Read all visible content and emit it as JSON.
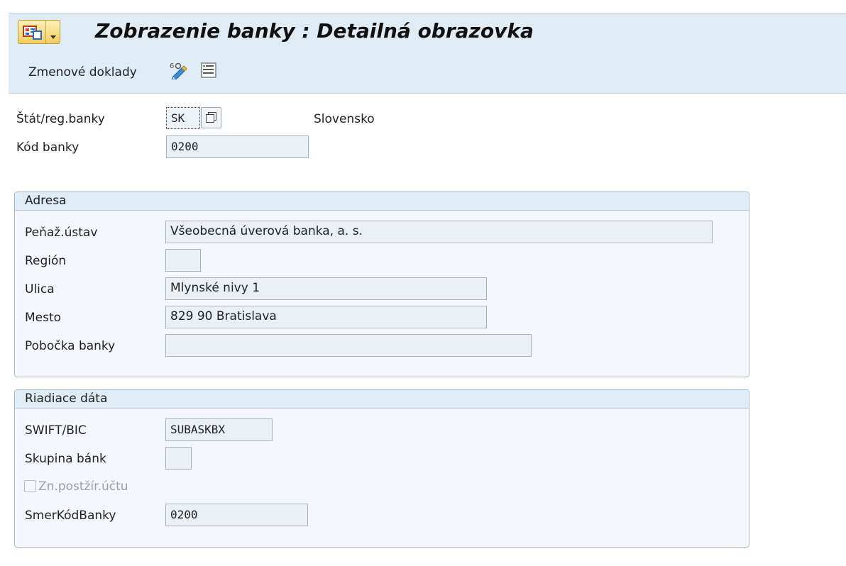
{
  "window": {
    "title": "Zobrazenie banky : Detailná obrazovka"
  },
  "toolbar": {
    "change_docs_label": "Zmenové doklady",
    "icons": [
      "display-change-icon",
      "document-details-icon"
    ]
  },
  "header_fields": {
    "country_label": "Štát/reg.banky",
    "country_value": "SK",
    "country_name": "Slovensko",
    "bank_key_label": "Kód banky",
    "bank_key_value": "0200"
  },
  "address": {
    "title": "Adresa",
    "bank_name_label": "Peňaž.ústav",
    "bank_name_value": "Všeobecná úverová banka, a. s.",
    "region_label": "Región",
    "region_value": "",
    "street_label": "Ulica",
    "street_value": "Mlynské nivy 1",
    "city_label": "Mesto",
    "city_value": "829 90 Bratislava",
    "branch_label": "Pobočka banky",
    "branch_value": ""
  },
  "control": {
    "title": "Riadiace dáta",
    "swift_label": "SWIFT/BIC",
    "swift_value": "SUBASKBX",
    "bank_group_label": "Skupina bánk",
    "bank_group_value": "",
    "postal_checkbox_label": "Zn.postžír.účtu",
    "postal_checkbox_checked": false,
    "bank_number_label": "SmerKódBanky",
    "bank_number_value": "0200"
  },
  "colors": {
    "header_bg": "#dfebf5",
    "field_bg": "#e9f0f6",
    "menu_button": "#f0cc5c"
  }
}
